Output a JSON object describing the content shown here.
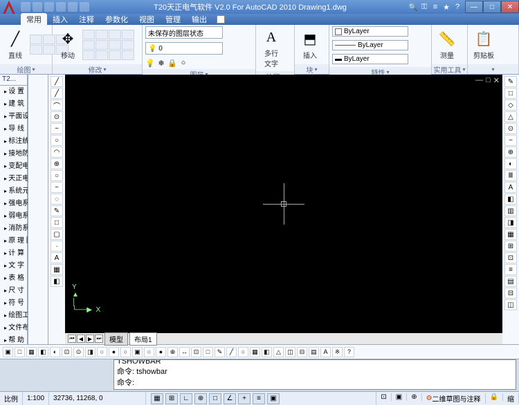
{
  "title": "T20天正电气软件 V2.0 For AutoCAD 2010    Drawing1.dwg",
  "menubar": {
    "items": [
      "常用",
      "插入",
      "注释",
      "参数化",
      "视图",
      "管理",
      "输出"
    ],
    "active": 0
  },
  "ribbon": {
    "draw": {
      "label": "绘图",
      "line": "直线"
    },
    "modify": {
      "label": "修改",
      "move": "移动"
    },
    "layer": {
      "label": "图层",
      "state": "未保存的图层状态",
      "zero": "0"
    },
    "annot": {
      "label": "注释",
      "mtext": "多行\n文字"
    },
    "block": {
      "label": "块",
      "insert": "插入"
    },
    "props": {
      "label": "特性",
      "bylayer": "ByLayer"
    },
    "util": {
      "label": "实用工具",
      "measure": "测量"
    },
    "clip": {
      "label": "",
      "paste": "剪贴板"
    }
  },
  "sidebar": {
    "tab": "T2...",
    "items": [
      "设    置",
      "建    筑",
      "平面设备",
      "导    线",
      "标注统计",
      "接地防雷",
      "变配电室",
      "天正电气",
      "系统元件",
      "强电系统",
      "弱电系统",
      "消防系统",
      "原 理 图",
      "计    算",
      "文    字",
      "表    格",
      "尺    寸",
      "符    号",
      "绘图工具",
      "文件布图",
      "帮    助"
    ]
  },
  "modeltabs": {
    "model": "模型",
    "layout": "布局1"
  },
  "cmd": {
    "l1": "TSHOWBAR",
    "l2": "命令: tshowbar",
    "l3": "命令:"
  },
  "status": {
    "scale_lbl": "比例",
    "scale": "1:100",
    "coords": "32736, 11268, 0",
    "ws": "二维草图与注释",
    "ws2": "缩"
  },
  "righttools": [
    "✎",
    "□",
    "◇",
    "△",
    "⊙",
    "~",
    "⊕",
    "◐",
    "Ⅲ",
    "A",
    "◧",
    "▥",
    "◨",
    "▦",
    "⊞",
    "⊡",
    "≡",
    "▤",
    "⊟",
    "◫"
  ],
  "lefttools": [
    "╱",
    "╱",
    "⌒",
    "⊙",
    "~",
    "○",
    "◠",
    "⊕",
    "○",
    "~",
    "◌",
    "✎",
    "□",
    "▢",
    "·",
    "A",
    "▦",
    "◧"
  ],
  "bottomtools": [
    "▣",
    "□",
    "▦",
    "◧",
    "◐",
    "⊡",
    "⊙",
    "◨",
    "○",
    "●",
    "○",
    "▣",
    "○",
    "●",
    "⊕",
    "↔",
    "⊡",
    "□",
    "✎",
    "╱",
    "○",
    "▦",
    "◧",
    "△",
    "◫",
    "⊟",
    "▤",
    "A",
    "※",
    "?"
  ]
}
